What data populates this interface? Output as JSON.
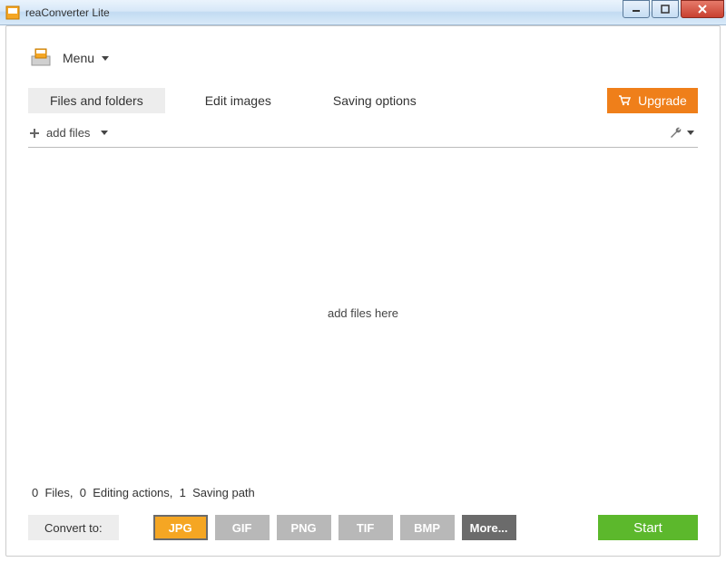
{
  "titlebar": {
    "title": "reaConverter Lite"
  },
  "menu": {
    "label": "Menu"
  },
  "tabs": {
    "files": "Files and folders",
    "edit": "Edit images",
    "saving": "Saving options"
  },
  "upgrade": {
    "label": "Upgrade"
  },
  "toolbar": {
    "add_files": "add files"
  },
  "dropzone": {
    "text": "add files here"
  },
  "status": {
    "files_count": "0",
    "files_label": "Files,",
    "actions_count": "0",
    "actions_label": "Editing actions,",
    "paths_count": "1",
    "paths_label": "Saving path"
  },
  "bottom": {
    "convert_label": "Convert to:",
    "formats": {
      "jpg": "JPG",
      "gif": "GIF",
      "png": "PNG",
      "tif": "TIF",
      "bmp": "BMP",
      "more": "More..."
    },
    "start": "Start"
  }
}
